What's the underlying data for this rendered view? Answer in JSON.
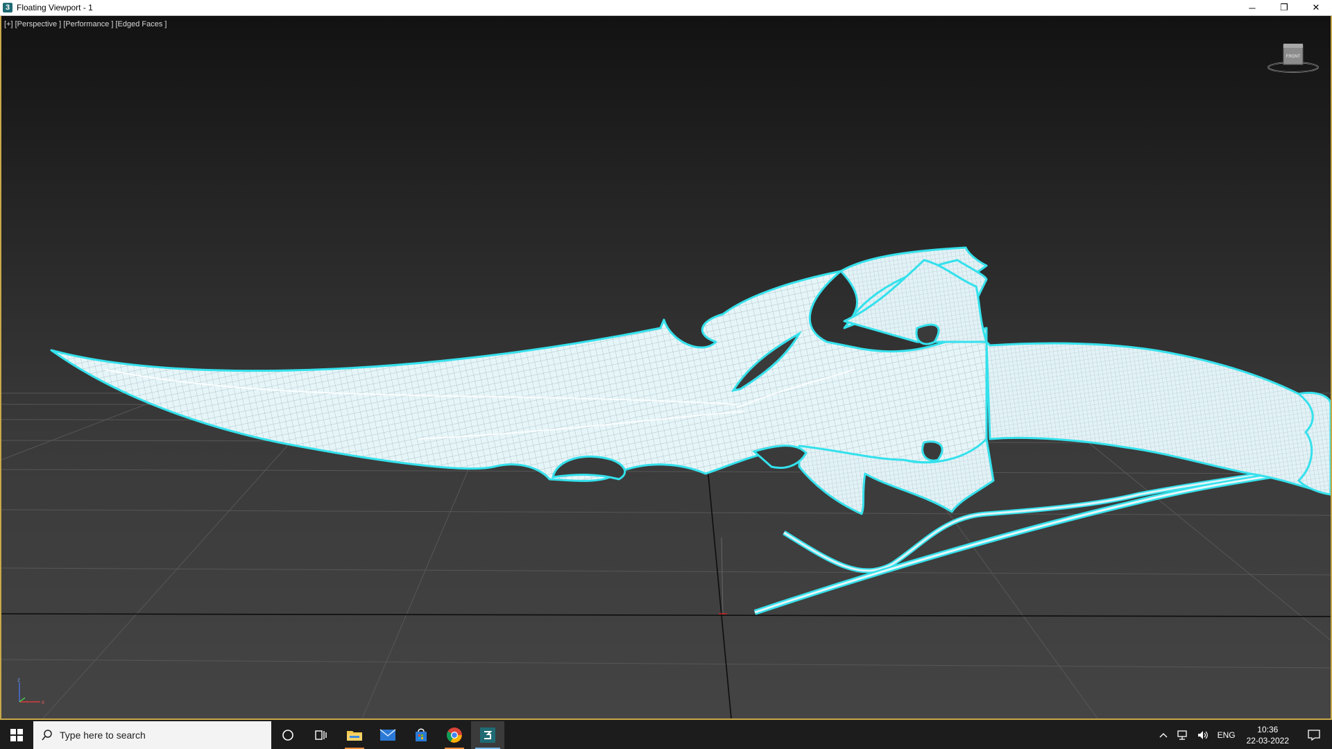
{
  "window": {
    "title": "Floating Viewport - 1",
    "app_icon_label": "3",
    "controls": {
      "minimize": "─",
      "restore": "❐",
      "close": "✕"
    }
  },
  "viewport": {
    "label": "[+] [Perspective ] [Performance ] [Edged Faces ]",
    "viewcube_label": "FRONT",
    "axis_labels": {
      "x": "x",
      "z": "z"
    },
    "model_color": "#e2f4f8",
    "outline_color": "#34e1ec",
    "grid_color": "#5a5a5a"
  },
  "taskbar": {
    "search_placeholder": "Type here to search",
    "icons": [
      "windows-start-icon",
      "search-icon",
      "cortana-icon",
      "task-view-icon",
      "file-explorer-icon",
      "mail-icon",
      "store-icon",
      "chrome-icon",
      "3dsmax-icon"
    ],
    "tray": {
      "language": "ENG",
      "time": "10:36",
      "date": "22-03-2022"
    }
  }
}
